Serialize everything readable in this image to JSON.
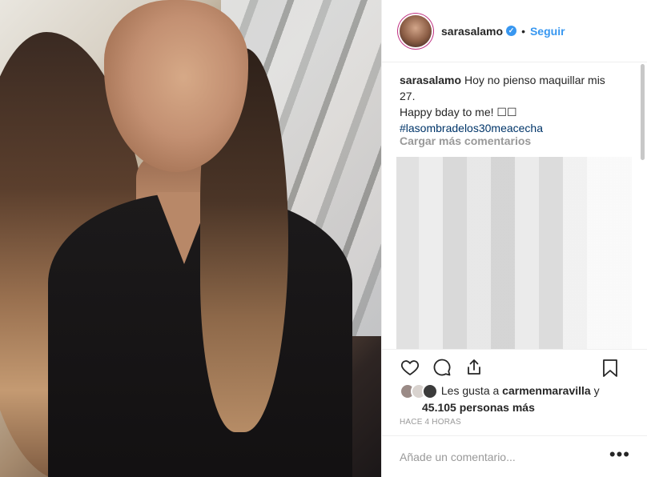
{
  "post": {
    "author": "sarasalamo",
    "verified_icon": "✓",
    "separator": "•",
    "follow_label": "Seguir",
    "caption_user": "sarasalamo",
    "caption_text_1": "Hoy no pienso maquillar mis",
    "caption_text_2": "27.",
    "caption_text_3": "Happy bday to me! ☐☐",
    "caption_hashtag": "#lasombradelos30meacecha",
    "load_more": "Cargar más comentarios"
  },
  "likes": {
    "prefix": "Les gusta a",
    "user": "carmenmaravilla",
    "suffix": "y",
    "count_text": "45.105 personas más"
  },
  "timestamp": "HACE 4 HORAS",
  "comment_box": {
    "placeholder": "Añade un comentario...",
    "more_label": "•••"
  },
  "icons": {
    "like": "heart-icon",
    "comment": "comment-icon",
    "share": "share-icon",
    "save": "bookmark-icon"
  },
  "colors": {
    "link": "#3897f0",
    "hashtag": "#003569",
    "muted": "#999999",
    "text": "#262626"
  }
}
